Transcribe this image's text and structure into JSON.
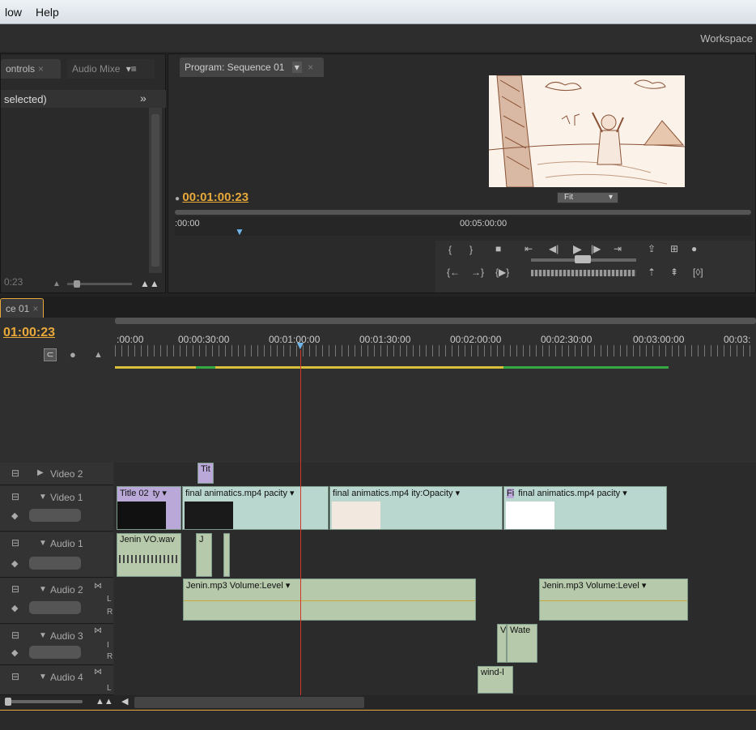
{
  "menu": [
    "low",
    "Help"
  ],
  "workspace_label": "Workspace",
  "left_panel": {
    "tabs": [
      {
        "label": "ontrols",
        "close": "×"
      },
      {
        "label": "Audio Mixe",
        "menu": "▾≡"
      }
    ],
    "selected_text": "selected)",
    "bottom_tc": "0:23",
    "expand_icon": "»"
  },
  "program": {
    "tab_label": "Program: Sequence 01",
    "timecode": "00:01:00:23",
    "fit_label": "Fit",
    "ruler": [
      ":00:00",
      "00:05:00:00"
    ]
  },
  "sequence_tab": "ce 01",
  "timeline": {
    "timecode": "01:00:23",
    "ruler": [
      ":00:00",
      "00:00:30:00",
      "00:01:00:00",
      "00:01:30:00",
      "00:02:00:00",
      "00:02:30:00",
      "00:03:00:00",
      "00:03:"
    ],
    "tracks": {
      "video2": "Video 2",
      "video1": "Video 1",
      "audio1": "Audio 1",
      "audio2": "Audio 2",
      "audio3": "Audio 3",
      "audio4": "Audio 4"
    },
    "clips": {
      "title_v2": "Tit",
      "title_v1": "Title 02",
      "title_v1_fx": "ty ▾",
      "v1_a": "final animatics.mp4  pacity ▾",
      "v1_b": "final animatics.mp4  ity:Opacity ▾",
      "v1_c_prefix": "Fi",
      "v1_c": "final animatics.mp4  pacity ▾",
      "a1": "Jenin VO.wav",
      "a1_b": "J",
      "a2_a": "Jenin.mp3  Volume:Level ▾",
      "a2_b": "Jenin.mp3  Volume:Level ▾",
      "a3_a": "V",
      "a3_b": "Wate",
      "a4": "wind-l"
    },
    "channel_labels": [
      "L",
      "R"
    ],
    "channel_I": "I"
  },
  "colors": {
    "accent": "#e8a93a",
    "playhead": "#d0352a",
    "video_clip": "#b9d7cf",
    "audio_clip": "#b7c9ab",
    "title_clip": "#b9a8d8"
  }
}
